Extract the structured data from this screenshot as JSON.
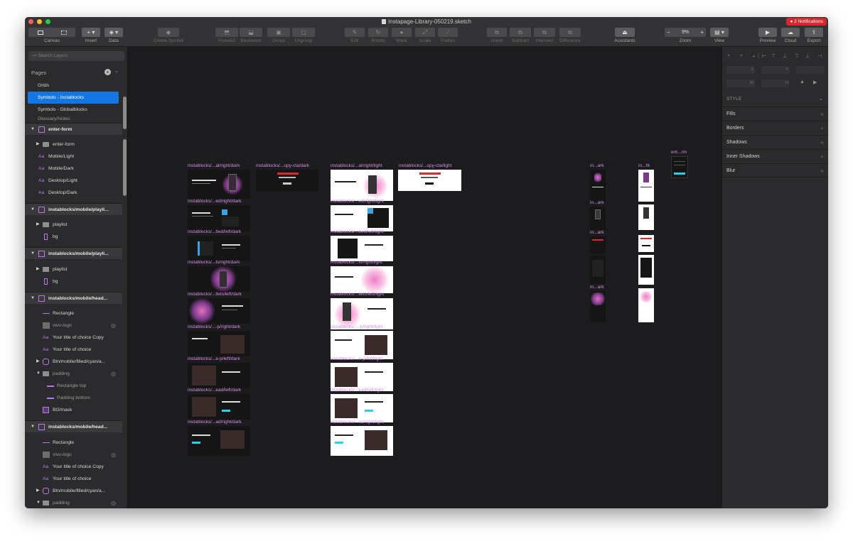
{
  "window": {
    "title": "Instapage-Library-050219.sketch",
    "notifications": "2 Notifications"
  },
  "toolbar": {
    "canvas": "Canvas",
    "insert": "Insert",
    "data": "Data",
    "create_symbol": "Create Symbol",
    "forward": "Forward",
    "backward": "Backward",
    "group": "Group",
    "ungroup": "Ungroup",
    "edit": "Edit",
    "rotate": "Rotate",
    "mask": "Mask",
    "scale": "Scale",
    "flatten": "Flatten",
    "union": "Union",
    "subtract": "Subtract",
    "intersect": "Intersect",
    "difference": "Difference",
    "assistants": "Assistants",
    "zoom_value": "9%",
    "zoom": "Zoom",
    "view": "View",
    "preview": "Preview",
    "cloud": "Cloud",
    "export": "Export"
  },
  "sidebar": {
    "search_placeholder": "Search Layers",
    "pages_header": "Pages",
    "pages": [
      {
        "label": "Grids"
      },
      {
        "label": "Symbols - Instablocks"
      },
      {
        "label": "Symbols - Globalblocks"
      },
      {
        "label": "Glossary/Notes"
      }
    ],
    "layers": [
      {
        "label": "enter-form"
      },
      {
        "label": "enter-form"
      },
      {
        "label": "Mobile/Light"
      },
      {
        "label": "Mobile/Dark"
      },
      {
        "label": "Desktop/Light"
      },
      {
        "label": "Desktop/Dark"
      },
      {
        "label": "instablocks/mobile/playli..."
      },
      {
        "label": "playlist"
      },
      {
        "label": "bg"
      },
      {
        "label": "instablocks/mobile/playli..."
      },
      {
        "label": "playlist"
      },
      {
        "label": "bg"
      },
      {
        "label": "instablocks/mobile/head..."
      },
      {
        "label": "Rectangle"
      },
      {
        "label": "vivo-logo"
      },
      {
        "label": "Your title of choice Copy"
      },
      {
        "label": "Your title of choice"
      },
      {
        "label": "Btn/mobile/filled/cyan/a..."
      },
      {
        "label": "padding"
      },
      {
        "label": "Rectangle top"
      },
      {
        "label": "Padding bottom"
      },
      {
        "label": "BG/mask"
      },
      {
        "label": "instablocks/mobile/head..."
      },
      {
        "label": "Rectangle"
      },
      {
        "label": "vivo-logo"
      },
      {
        "label": "Your title of choice Copy"
      },
      {
        "label": "Your title of choice"
      },
      {
        "label": "Btn/mobile/filled/cyan/a..."
      },
      {
        "label": "padding"
      }
    ]
  },
  "canvas": {
    "group_titles": [
      "Desktop/Dark",
      "Desktop/Light",
      "Mobile/Dark",
      "Mobile/Light"
    ],
    "col_dark": [
      {
        "label": "instablocks/...al/right/dark"
      },
      {
        "label": "instablocks/...ed/right/dark"
      },
      {
        "label": "instablocks/...bed/left/dark"
      },
      {
        "label": "instablocks/...ts/right/dark"
      },
      {
        "label": "instablocks/...llets/left/dark"
      },
      {
        "label": "instablocks/...-p/right/dark"
      },
      {
        "label": "instablocks/...e-p/left/dark"
      },
      {
        "label": "instablocks/...ead/left/dark"
      },
      {
        "label": "instablocks/...ad/right/dark"
      }
    ],
    "cta_dark": "instablocks/...opy-cta/dark",
    "col_light": [
      {
        "label": "instablocks/...al/right/light"
      },
      {
        "label": "instablocks/...ed/right/light"
      },
      {
        "label": "instablocks/...bed/left/light"
      },
      {
        "label": "instablocks/...ts/right/light"
      },
      {
        "label": "instablocks/...llets/left/light"
      },
      {
        "label": "instablocks/...-p/right/light"
      },
      {
        "label": "instablocks/...e-p/left/light"
      },
      {
        "label": "instablocks/...ead/left/light"
      },
      {
        "label": "instablocks/...ad/right/light"
      }
    ],
    "cta_light": "instablocks/...opy-cta/light",
    "mobile_dark_labels": [
      {
        "label": "in...ark"
      },
      {
        "label": "in...ark"
      },
      {
        "label": "in...ark"
      },
      {
        "label": "in...ark"
      },
      {
        "label": "in...ark"
      }
    ],
    "mobile_light_label": "in...ht",
    "form_label": "ent...rm"
  },
  "inspector": {
    "style_header": "STYLE",
    "sections": [
      {
        "label": "Fills"
      },
      {
        "label": "Borders"
      },
      {
        "label": "Shadows"
      },
      {
        "label": "Inner Shadows"
      },
      {
        "label": "Blur"
      }
    ],
    "field_x": "X",
    "field_y": "Y",
    "field_w": "W",
    "field_h": "H"
  },
  "colors": {
    "selection": "#1376e3",
    "accent_pink": "#d28ee6",
    "notification": "#d8262d",
    "cta_red": "#e0262d",
    "cyan": "#28d0e8"
  }
}
